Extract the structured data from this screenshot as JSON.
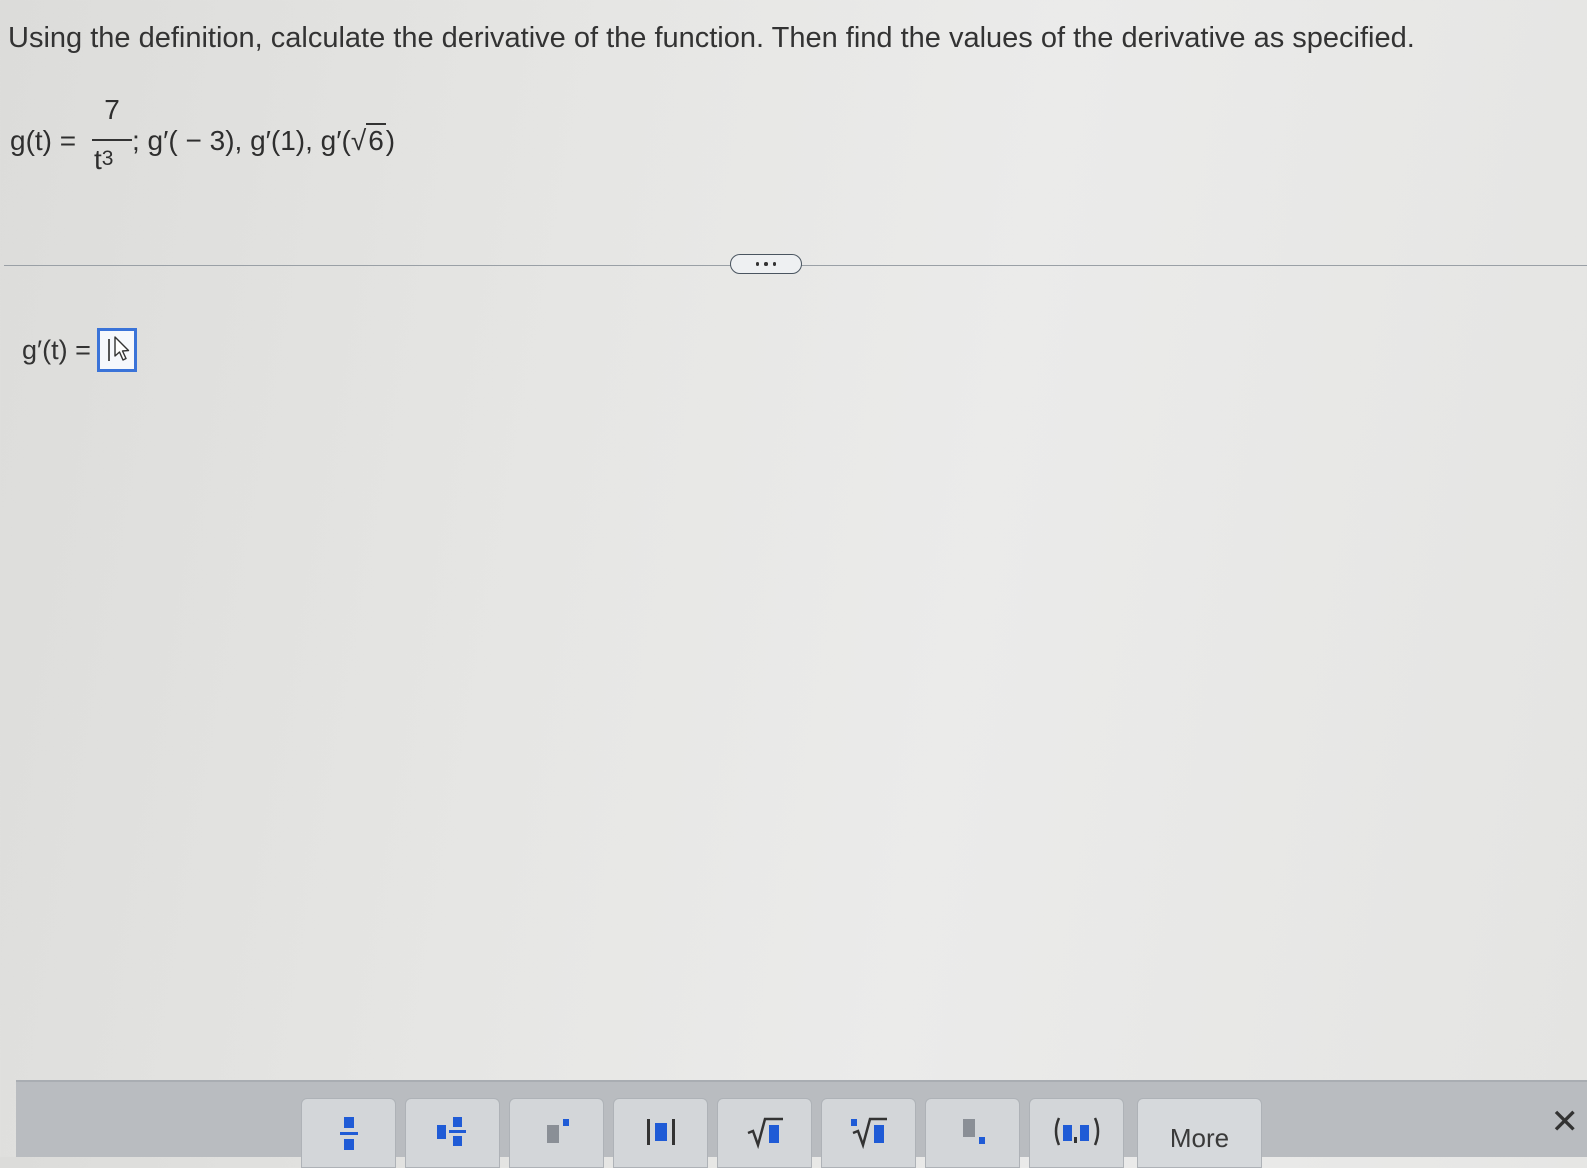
{
  "question": {
    "instruction": "Using the definition, calculate the derivative of the function. Then find the values of the derivative as specified."
  },
  "problem": {
    "lhs": "g(t) =",
    "numerator": "7",
    "denominator_base": "t",
    "denominator_exponent": "3",
    "rest_prefix": "; g′( − 3), g′(1), g′(",
    "sqrt_radicand": "6",
    "rest_suffix": ")"
  },
  "answer": {
    "label": "g′(t) =",
    "value": ""
  },
  "toolbar": {
    "buttons": [
      "fraction-icon",
      "mixed-number-icon",
      "exponent-icon",
      "absolute-value-icon",
      "square-root-icon",
      "nth-root-icon",
      "subscript-icon",
      "ordered-pair-icon"
    ],
    "more_label": "More",
    "close_glyph": "✕",
    "accent_color": "#1f5bd6"
  }
}
